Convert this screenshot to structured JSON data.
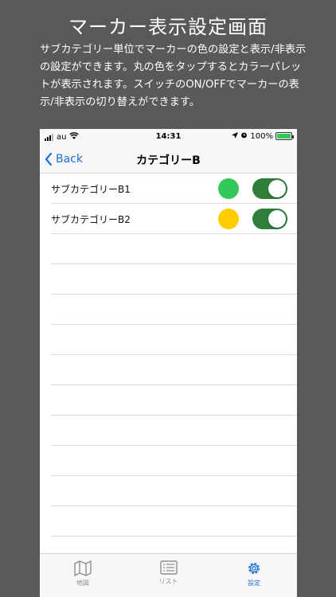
{
  "promo": {
    "title": "マーカー表示設定画面",
    "description": "サブカテゴリー単位でマーカーの色の設定と表示/非表示の設定ができます。丸の色をタップするとカラーパレットが表示されます。スイッチのON/OFFでマーカーの表示/非表示の切り替えができます。"
  },
  "status_bar": {
    "carrier": "au",
    "time": "14:31",
    "battery": "100%",
    "icons": [
      "signal-icon",
      "wifi-icon",
      "location-arrow-icon",
      "alarm-icon",
      "battery-charging-icon"
    ]
  },
  "navbar": {
    "back_label": "Back",
    "title": "カテゴリーB"
  },
  "subcategories": [
    {
      "label": "サブカテゴリーB1",
      "color": "#34c759",
      "enabled": true
    },
    {
      "label": "サブカテゴリーB2",
      "color": "#ffcc00",
      "enabled": true
    }
  ],
  "empty_rows": 10,
  "tabbar": {
    "tabs": [
      {
        "label": "地図",
        "icon": "map-icon",
        "active": false
      },
      {
        "label": "リスト",
        "icon": "list-icon",
        "active": false
      },
      {
        "label": "設定",
        "icon": "gear-icon",
        "active": true
      }
    ],
    "active_color": "#1e6fdb",
    "inactive_color": "#8e8e93"
  },
  "colors": {
    "background": "#595959",
    "toggle_on": "#2e7d3a",
    "accent": "#1e6fdb"
  }
}
